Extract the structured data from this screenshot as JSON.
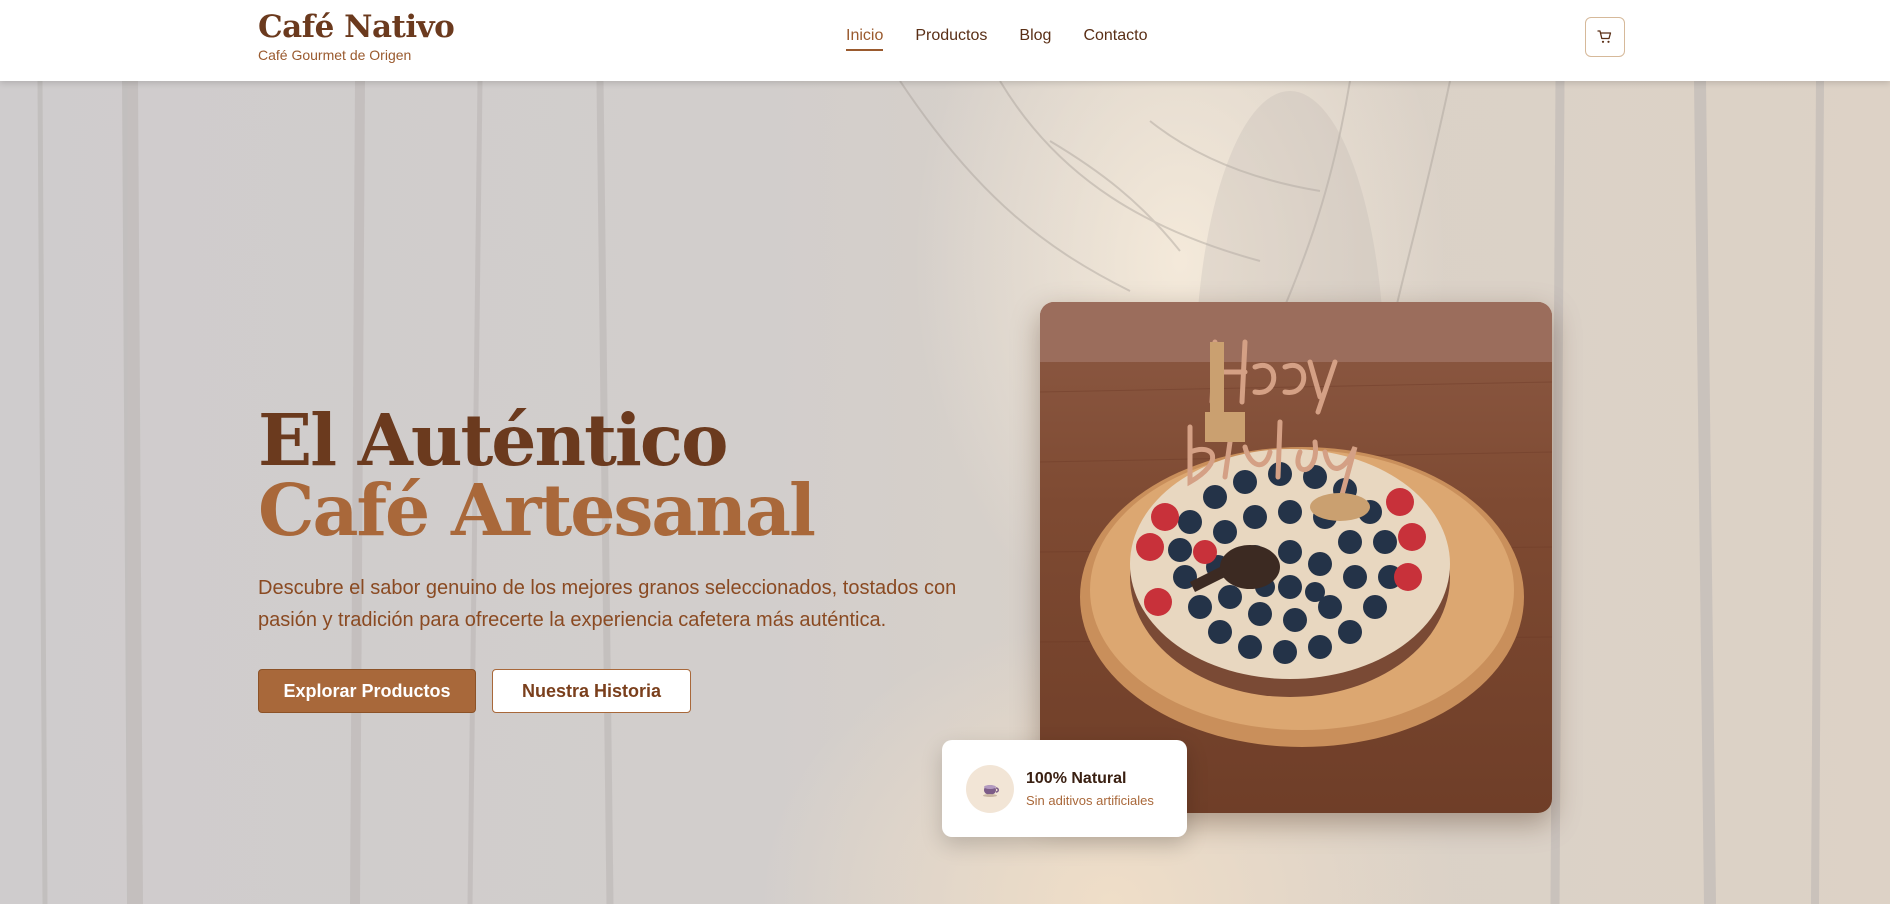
{
  "brand": {
    "title": "Café Nativo",
    "subtitle": "Café Gourmet de Origen"
  },
  "nav": {
    "items": [
      "Inicio",
      "Productos",
      "Blog",
      "Contacto"
    ],
    "active": "Inicio"
  },
  "cart": {
    "icon": "shopping-cart-icon"
  },
  "hero": {
    "headline_line1": "El Auténtico",
    "headline_line2": "Café Artesanal",
    "description": "Descubre el sabor genuino de los mejores granos seleccionados, tostados con pasión y tradición para ofrecerte la experiencia cafetera más auténtica.",
    "primary_button": "Explorar Productos",
    "secondary_button": "Nuestra Historia"
  },
  "image": {
    "subject": "birthday cake with blueberries, raspberries and 'Happy Birthday' topper",
    "topper_text": "Happy Birthday"
  },
  "badge": {
    "icon": "coffee-cup-icon",
    "title": "100% Natural",
    "subtitle": "Sin aditivos artificiales"
  },
  "colors": {
    "brand_dark": "#6b3a1e",
    "brand_accent": "#a8683a",
    "background": "#d8d3ce"
  }
}
